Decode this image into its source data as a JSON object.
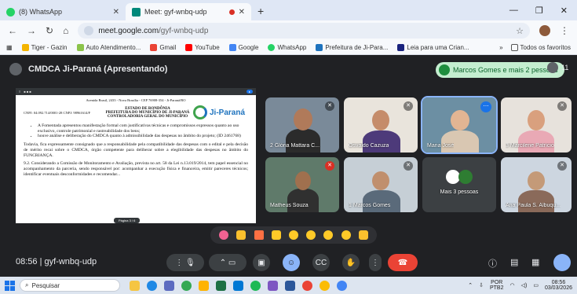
{
  "browser": {
    "tabs": [
      {
        "label": "(8) WhatsApp",
        "favicon_color": "#25d366"
      },
      {
        "label": "Meet: gyf-wnbq-udp",
        "favicon_color": "#00897b",
        "recording": true
      }
    ],
    "url_host": "meet.google.com",
    "url_path": "/gyf-wnbq-udp",
    "bookmarks": [
      {
        "label": "Tiger - Gazin",
        "color": "#f4b400"
      },
      {
        "label": "Auto Atendimento...",
        "color": "#8bc34a"
      },
      {
        "label": "Gmail",
        "color": "#ea4335"
      },
      {
        "label": "YouTube",
        "color": "#ff0000"
      },
      {
        "label": "Google",
        "color": "#4285f4"
      },
      {
        "label": "WhatsApp",
        "color": "#25d366"
      },
      {
        "label": "Prefeitura de Ji-Para...",
        "color": "#1e73be"
      },
      {
        "label": "Leia para uma Crian...",
        "color": "#1a237e"
      }
    ],
    "favorites_label": "Todos os favoritos",
    "more_label": "»"
  },
  "meet": {
    "title": "CMDCA Ji-Paraná (Apresentando)",
    "people_pill": "Marcos Gomes e mais 2 pessoas",
    "people_count": "11",
    "meeting_code": "gyf-wnbq-udp",
    "time": "08:56",
    "separator": "|"
  },
  "document": {
    "header_small": "Avenida Brasil, 2433 - Nova Brasília - CEP 76908-354 - Ji-Paraná/RO",
    "cnpj": "CNPJ: 04.092.714/0001-28  CNPJ: 98961614/F",
    "state": "ESTADO DE RONDÔNIA",
    "city": "PREFEITURA DO MUNICÍPIO DE JI-PARANÁ",
    "dept": "CONTROLADORIA GERAL DO MUNICÍPIO",
    "logo_text": "Ji-Paraná",
    "bullets": [
      "A Fomentada apresentou manifestação formal com justificativas técnicas e compromissos expressos quanto ao uso exclusivo, controle patrimonial e rastreabilidade dos bens;",
      "houve análise e deliberação do CMDCA quanto à admissibilidade das despesas no âmbito do projeto; (ID 2461768)"
    ],
    "para1": "Todavia, fica expressamente consignado que a responsabilidade pela compatibilidade das despesas com o edital e pela decisão de mérito recai sobre o CMDCA, órgão competente para deliberar sobre a elegibilidade das despesas no âmbito do FUNCRIANÇA.",
    "para2": "9.2. Considerando a Comissão de Monitoramento e Avaliação, prevista no art. 58 da Lei n.13.019/2014, tem papel essencial no acompanhamento da parceria, sendo responsável por: acompanhar a execução física e financeira, emitir pareceres técnicos; identificar eventuais desconformidades e recomendar...",
    "pager": "Página 3 / 6"
  },
  "participants": [
    {
      "name": "Glória Mattara C...",
      "count": "2",
      "muted": true
    },
    {
      "name": "Osvaldo Cazuza",
      "muted": true
    },
    {
      "name": "Maria José",
      "speaking": true
    },
    {
      "name": "Marcilene Patrício",
      "count": "3",
      "muted": true
    },
    {
      "name": "Matheus Souza",
      "muted": true
    },
    {
      "name": "Marcos Gomes",
      "count": "1",
      "muted": true
    },
    {
      "name": "Mais 3 pessoas"
    },
    {
      "name": "Ana Paula S. Albuqu...",
      "muted": true
    }
  ],
  "reactions": [
    "sparkling-heart",
    "thumbs-up",
    "party-popper",
    "clapping-hands",
    "joy",
    "surprised",
    "crying",
    "thinking",
    "thumbs-down"
  ],
  "reaction_colors": [
    "#f06292",
    "#fbc02d",
    "#ff7043",
    "#ffca28",
    "#ffca28",
    "#ffca28",
    "#ffca28",
    "#ffca28",
    "#fbc02d"
  ],
  "taskbar": {
    "search_placeholder": "Pesquisar",
    "lang_top": "POR",
    "lang_bottom": "PTB2",
    "time": "08:56",
    "date": "03/03/2026"
  }
}
